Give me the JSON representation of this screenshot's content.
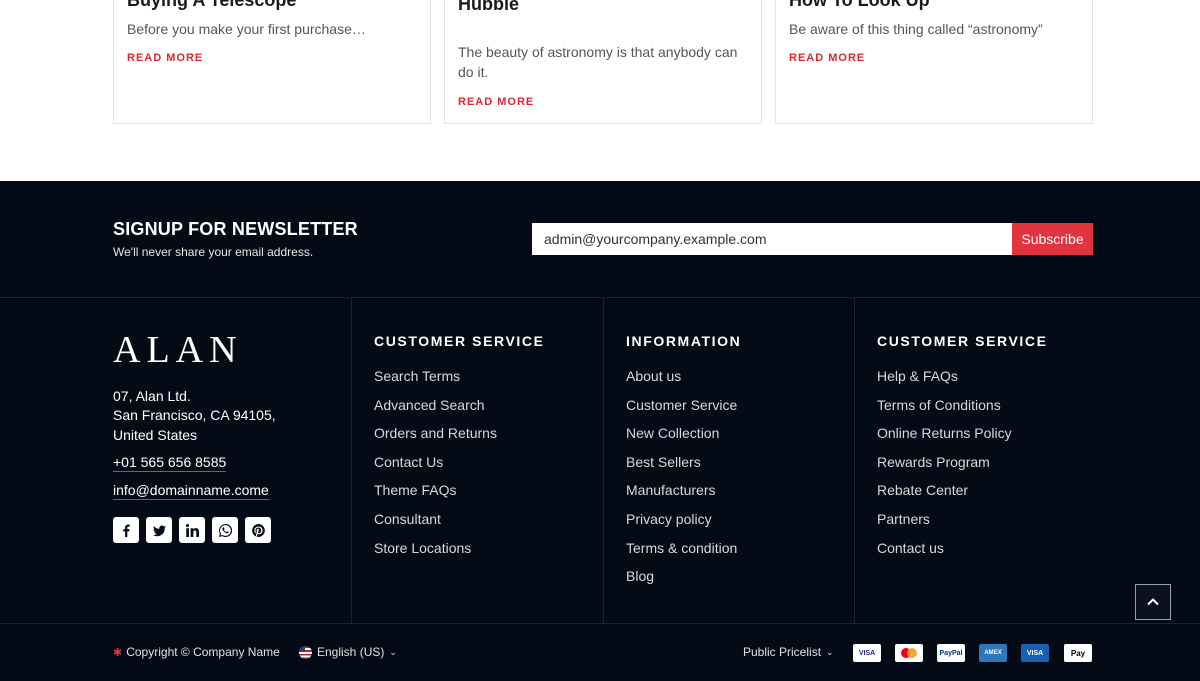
{
  "blog_cards": [
    {
      "title": "Buying A Telescope",
      "excerpt": "Before you make your first purchase…",
      "more": "READ MORE"
    },
    {
      "title": "What If They Let You Run The Hubble",
      "excerpt": "The beauty of astronomy is that anybody can do it.",
      "more": "READ MORE"
    },
    {
      "title": "How To Look Up",
      "excerpt": "Be aware of this thing called “astronomy”",
      "more": "READ MORE"
    }
  ],
  "newsletter": {
    "title": "SIGNUP FOR NEWSLETTER",
    "subtitle": "We'll never share your email address.",
    "email_value": "admin@yourcompany.example.com",
    "subscribe_label": "Subscribe"
  },
  "company": {
    "logo": "ALAN",
    "address_line1": "07, Alan Ltd.",
    "address_line2": "San Francisco, CA 94105,",
    "address_line3": "United States",
    "phone": "+01 565 656 8585",
    "email": "info@domainname.come",
    "socials": [
      "facebook-icon",
      "twitter-icon",
      "linkedin-icon",
      "whatsapp-icon",
      "pinterest-icon"
    ]
  },
  "columns": [
    {
      "title": "CUSTOMER SERVICE",
      "items": [
        "Search Terms",
        "Advanced Search",
        "Orders and Returns",
        "Contact Us",
        "Theme FAQs",
        "Consultant",
        "Store Locations"
      ]
    },
    {
      "title": "INFORMATION",
      "items": [
        "About us",
        "Customer Service",
        "New Collection",
        "Best Sellers",
        "Manufacturers",
        "Privacy policy",
        "Terms & condition",
        "Blog"
      ]
    },
    {
      "title": "CUSTOMER SERVICE",
      "items": [
        "Help & FAQs",
        "Terms of Conditions",
        "Online Returns Policy",
        "Rewards Program",
        "Rebate Center",
        "Partners",
        "Contact us"
      ]
    }
  ],
  "bottom": {
    "copyright": "Copyright © Company Name",
    "language": "English (US)",
    "pricelist": "Public Pricelist",
    "payments": [
      "VISA",
      "MC",
      "PayPal",
      "AMEX",
      "VISA",
      "Pay"
    ]
  },
  "colors": {
    "accent": "#e0353f",
    "background": "#050a17"
  }
}
